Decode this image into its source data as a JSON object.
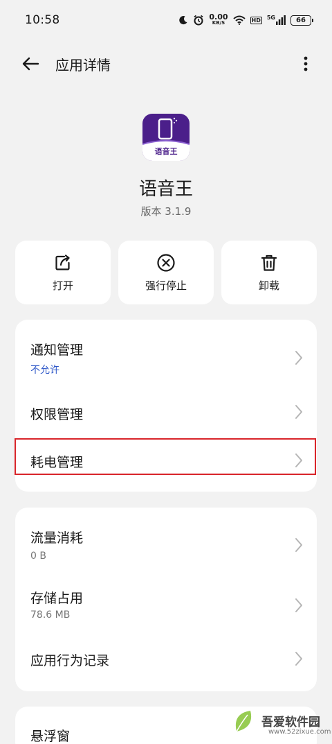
{
  "status_bar": {
    "time": "10:58",
    "net_speed_value": "0.00",
    "net_speed_unit": "KB/S",
    "hd": "HD",
    "signal_type": "5G",
    "battery": "66",
    "icons": [
      "moon-icon",
      "alarm-icon",
      "wifi-icon",
      "signal-icon"
    ]
  },
  "header": {
    "title": "应用详情",
    "back_icon": "back-arrow-icon",
    "more_icon": "more-vertical-icon"
  },
  "app": {
    "name": "语音王",
    "icon_text": "语音王",
    "version_label": "版本 3.1.9",
    "icon_colors": {
      "primary": "#4b1f8a",
      "band": "#ffffff"
    }
  },
  "actions": [
    {
      "label": "打开",
      "icon": "open-external-icon"
    },
    {
      "label": "强行停止",
      "icon": "force-stop-icon"
    },
    {
      "label": "卸载",
      "icon": "trash-icon"
    }
  ],
  "card1": [
    {
      "title": "通知管理",
      "subtitle": "不允许"
    },
    {
      "title": "权限管理"
    },
    {
      "title": "耗电管理"
    }
  ],
  "card2": [
    {
      "title": "流量消耗",
      "subtitle": "0 B"
    },
    {
      "title": "存储占用",
      "subtitle": "78.6 MB"
    },
    {
      "title": "应用行为记录"
    }
  ],
  "card3": [
    {
      "title": "悬浮窗"
    }
  ],
  "watermark": {
    "line1": "吾爱软件园",
    "line2": "www.52zixue.com"
  },
  "colors": {
    "background": "#f2f2f2",
    "card": "#ffffff",
    "link_blue": "#2f58c8",
    "highlight_red": "#d9252a"
  }
}
